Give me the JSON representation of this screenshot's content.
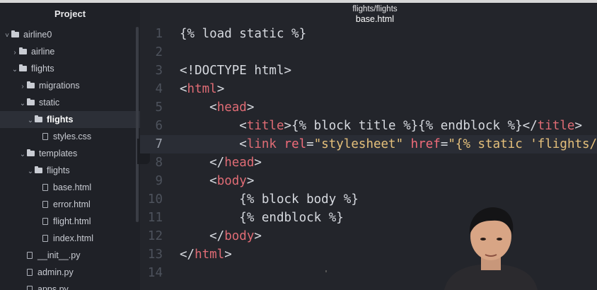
{
  "sidebar": {
    "title": "Project",
    "items": [
      {
        "label": "airline0",
        "arrow": "˅",
        "type": "folder"
      },
      {
        "label": "airline",
        "arrow": "›",
        "type": "folder"
      },
      {
        "label": "flights",
        "arrow": "⌄",
        "type": "folder"
      },
      {
        "label": "migrations",
        "arrow": "›",
        "type": "folder"
      },
      {
        "label": "static",
        "arrow": "⌄",
        "type": "folder"
      },
      {
        "label": "flights",
        "arrow": "⌄",
        "type": "folder",
        "selected": true
      },
      {
        "label": "styles.css",
        "type": "file"
      },
      {
        "label": "templates",
        "arrow": "⌄",
        "type": "folder"
      },
      {
        "label": "flights",
        "arrow": "⌄",
        "type": "folder"
      },
      {
        "label": "base.html",
        "type": "file"
      },
      {
        "label": "error.html",
        "type": "file"
      },
      {
        "label": "flight.html",
        "type": "file"
      },
      {
        "label": "index.html",
        "type": "file"
      },
      {
        "label": "__init__.py",
        "type": "file"
      },
      {
        "label": "admin.py",
        "type": "file"
      },
      {
        "label": "apps.py",
        "type": "file"
      }
    ]
  },
  "tab": {
    "path": "flights/flights",
    "name": "base.html"
  },
  "collapse_glyph": "‹",
  "editor": {
    "active_line": 7,
    "lines": [
      {
        "n": "1",
        "tokens": [
          {
            "t": "{% load static %}",
            "c": "plain"
          }
        ]
      },
      {
        "n": "2",
        "tokens": []
      },
      {
        "n": "3",
        "tokens": [
          {
            "t": "<!DOCTYPE html>",
            "c": "plain"
          }
        ]
      },
      {
        "n": "4",
        "tokens": [
          {
            "t": "<",
            "c": "plain"
          },
          {
            "t": "html",
            "c": "tag"
          },
          {
            "t": ">",
            "c": "plain"
          }
        ]
      },
      {
        "n": "5",
        "tokens": [
          {
            "t": "    <",
            "c": "plain"
          },
          {
            "t": "head",
            "c": "tag"
          },
          {
            "t": ">",
            "c": "plain"
          }
        ]
      },
      {
        "n": "6",
        "tokens": [
          {
            "t": "        <",
            "c": "plain"
          },
          {
            "t": "title",
            "c": "tag"
          },
          {
            "t": ">{% block title %}{% endblock %}</",
            "c": "plain"
          },
          {
            "t": "title",
            "c": "tag"
          },
          {
            "t": ">",
            "c": "plain"
          }
        ]
      },
      {
        "n": "7",
        "tokens": [
          {
            "t": "        <",
            "c": "plain"
          },
          {
            "t": "link",
            "c": "tag"
          },
          {
            "t": " ",
            "c": "plain"
          },
          {
            "t": "rel",
            "c": "attr"
          },
          {
            "t": "=",
            "c": "plain"
          },
          {
            "t": "\"stylesheet\"",
            "c": "str"
          },
          {
            "t": " ",
            "c": "plain"
          },
          {
            "t": "href",
            "c": "attr"
          },
          {
            "t": "=",
            "c": "plain"
          },
          {
            "t": "\"{% static 'flights/s",
            "c": "str"
          }
        ]
      },
      {
        "n": "8",
        "tokens": [
          {
            "t": "    </",
            "c": "plain"
          },
          {
            "t": "head",
            "c": "tag"
          },
          {
            "t": ">",
            "c": "plain"
          }
        ]
      },
      {
        "n": "9",
        "tokens": [
          {
            "t": "    <",
            "c": "plain"
          },
          {
            "t": "body",
            "c": "tag"
          },
          {
            "t": ">",
            "c": "plain"
          }
        ]
      },
      {
        "n": "10",
        "tokens": [
          {
            "t": "        {% block body %}",
            "c": "plain"
          }
        ]
      },
      {
        "n": "11",
        "tokens": [
          {
            "t": "        {% endblock %}",
            "c": "plain"
          }
        ]
      },
      {
        "n": "12",
        "tokens": [
          {
            "t": "    </",
            "c": "plain"
          },
          {
            "t": "body",
            "c": "tag"
          },
          {
            "t": ">",
            "c": "plain"
          }
        ]
      },
      {
        "n": "13",
        "tokens": [
          {
            "t": "</",
            "c": "plain"
          },
          {
            "t": "html",
            "c": "tag"
          },
          {
            "t": ">",
            "c": "plain"
          }
        ]
      },
      {
        "n": "14",
        "tokens": []
      }
    ]
  },
  "colors": {
    "background": "#23252b",
    "sidebar": "#1f2127",
    "tag": "#e06c75",
    "string": "#e5c07b",
    "text": "#d7dae0",
    "line_number": "#4d525c"
  }
}
